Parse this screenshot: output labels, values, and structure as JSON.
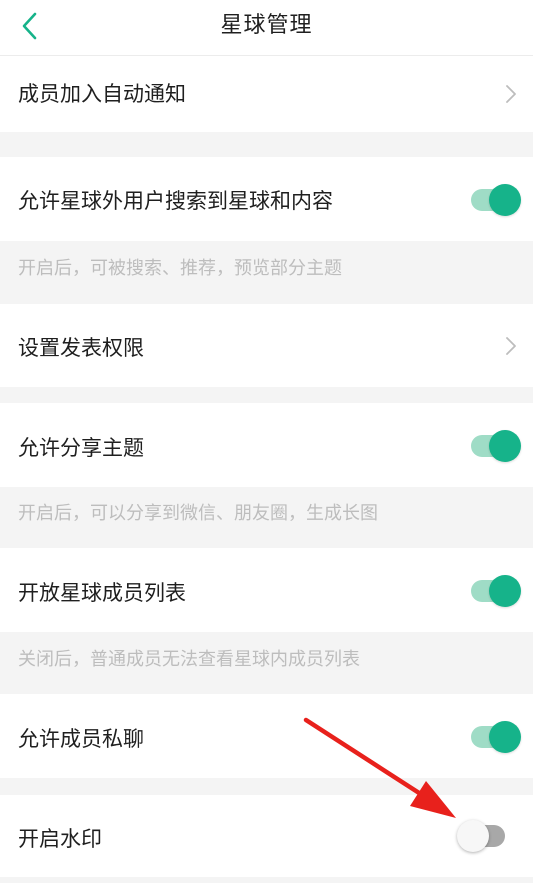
{
  "nav": {
    "title": "星球管理",
    "back_icon": "chevron-left-icon",
    "accent": "#16b38a"
  },
  "settings": {
    "member_join_notice": {
      "label": "成员加入自动通知"
    },
    "allow_external_search": {
      "label": "允许星球外用户搜索到星球和内容",
      "enabled": true,
      "hint": "开启后，可被搜索、推荐，预览部分主题"
    },
    "post_permission": {
      "label": "设置发表权限"
    },
    "allow_share": {
      "label": "允许分享主题",
      "enabled": true,
      "hint": "开启后，可以分享到微信、朋友圈，生成长图"
    },
    "open_member_list": {
      "label": "开放星球成员列表",
      "enabled": true,
      "hint": "关闭后，普通成员无法查看星球内成员列表"
    },
    "allow_private_chat": {
      "label": "允许成员私聊",
      "enabled": true
    },
    "watermark": {
      "label": "开启水印",
      "enabled": false
    }
  },
  "colors": {
    "toggle_on": "#16b38a",
    "toggle_off": "#a8a8a8",
    "annotation_arrow": "#e8211c"
  }
}
